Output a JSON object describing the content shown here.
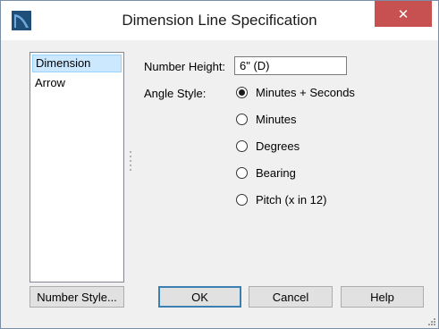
{
  "window": {
    "title": "Dimension Line Specification",
    "close_label": "✕"
  },
  "sidebar": {
    "items": [
      {
        "label": "Dimension",
        "selected": true
      },
      {
        "label": "Arrow",
        "selected": false
      }
    ]
  },
  "form": {
    "number_height_label": "Number Height:",
    "number_height_value": "6\" (D)",
    "angle_style_label": "Angle Style:",
    "angle_options": [
      {
        "label": "Minutes + Seconds",
        "checked": true
      },
      {
        "label": "Minutes",
        "checked": false
      },
      {
        "label": "Degrees",
        "checked": false
      },
      {
        "label": "Bearing",
        "checked": false
      },
      {
        "label": "Pitch (x in 12)",
        "checked": false
      }
    ]
  },
  "buttons": {
    "number_style": "Number Style...",
    "ok": "OK",
    "cancel": "Cancel",
    "help": "Help"
  },
  "colors": {
    "close_button": "#c75050",
    "selection": "#cce8ff",
    "app_icon": "#1f4e79"
  }
}
